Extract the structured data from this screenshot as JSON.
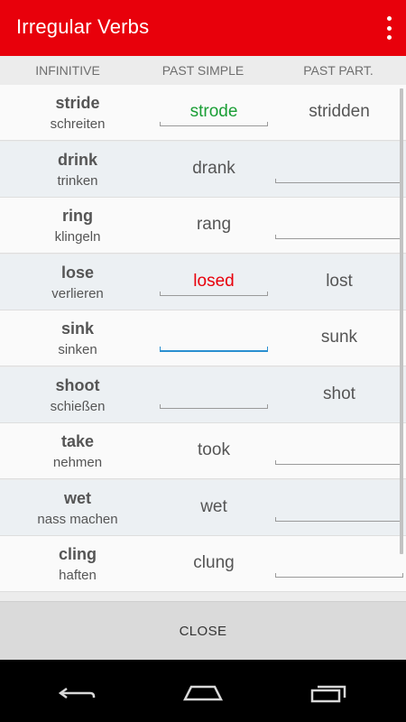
{
  "app": {
    "title": "Irregular Verbs"
  },
  "columns": {
    "infinitive": "INFINITIVE",
    "past_simple": "PAST SIMPLE",
    "past_participle": "PAST PART."
  },
  "rows": [
    {
      "verb": "stride",
      "translation": "schreiten",
      "past_simple": "strode",
      "past_simple_state": "correct",
      "past_participle": "stridden",
      "past_participle_state": "given"
    },
    {
      "verb": "drink",
      "translation": "trinken",
      "past_simple": "drank",
      "past_simple_state": "given",
      "past_participle": "",
      "past_participle_state": "empty"
    },
    {
      "verb": "ring",
      "translation": "klingeln",
      "past_simple": "rang",
      "past_simple_state": "given",
      "past_participle": "",
      "past_participle_state": "empty"
    },
    {
      "verb": "lose",
      "translation": "verlieren",
      "past_simple": "losed",
      "past_simple_state": "wrong",
      "past_participle": "lost",
      "past_participle_state": "given"
    },
    {
      "verb": "sink",
      "translation": "sinken",
      "past_simple": "",
      "past_simple_state": "active",
      "past_participle": "sunk",
      "past_participle_state": "given"
    },
    {
      "verb": "shoot",
      "translation": "schießen",
      "past_simple": "",
      "past_simple_state": "empty",
      "past_participle": "shot",
      "past_participle_state": "given"
    },
    {
      "verb": "take",
      "translation": "nehmen",
      "past_simple": "took",
      "past_simple_state": "given",
      "past_participle": "",
      "past_participle_state": "empty"
    },
    {
      "verb": "wet",
      "translation": "nass machen",
      "past_simple": "wet",
      "past_simple_state": "given",
      "past_participle": "",
      "past_participle_state": "empty"
    },
    {
      "verb": "cling",
      "translation": "haften",
      "past_simple": "clung",
      "past_simple_state": "given",
      "past_participle": "",
      "past_participle_state": "empty"
    }
  ],
  "footer": {
    "close_label": "CLOSE"
  },
  "icons": {
    "overflow_menu": "more-vert-icon",
    "nav_back": "back-icon",
    "nav_home": "home-icon",
    "nav_recents": "recents-icon"
  },
  "colors": {
    "app_bar": "#e8000b",
    "correct": "#1a9e35",
    "wrong": "#e8000b",
    "focus": "#2a8fd0"
  }
}
